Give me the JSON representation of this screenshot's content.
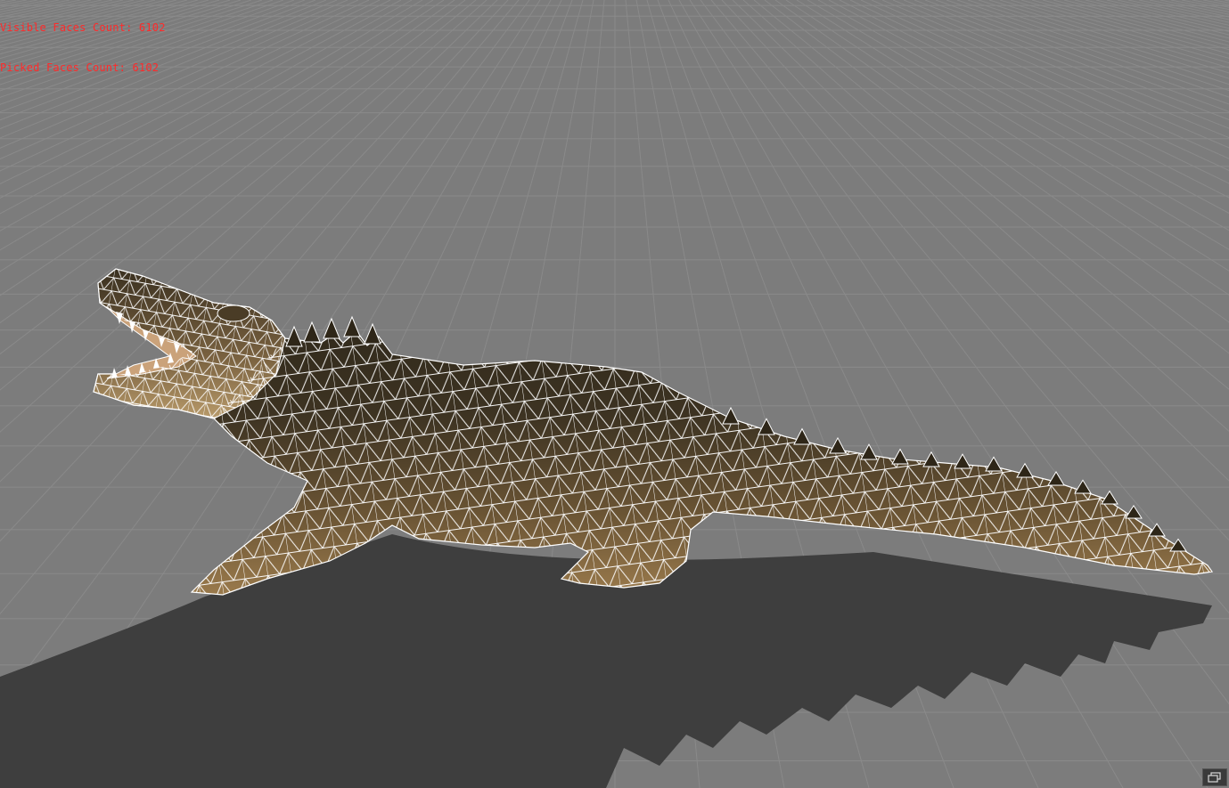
{
  "hud": {
    "visible_faces": "Visible Faces Count: 6102",
    "picked_faces": "Picked Faces Count: 6102"
  },
  "viewport": {
    "background_color": "#7c7c7c",
    "grid_color": "#8a8a8a",
    "shadow_color": "#3e3e3e",
    "wire_color": "#ffffff",
    "hud_color": "#ff2a2a"
  },
  "icons": {
    "view_toggle": "restore-window-icon"
  }
}
